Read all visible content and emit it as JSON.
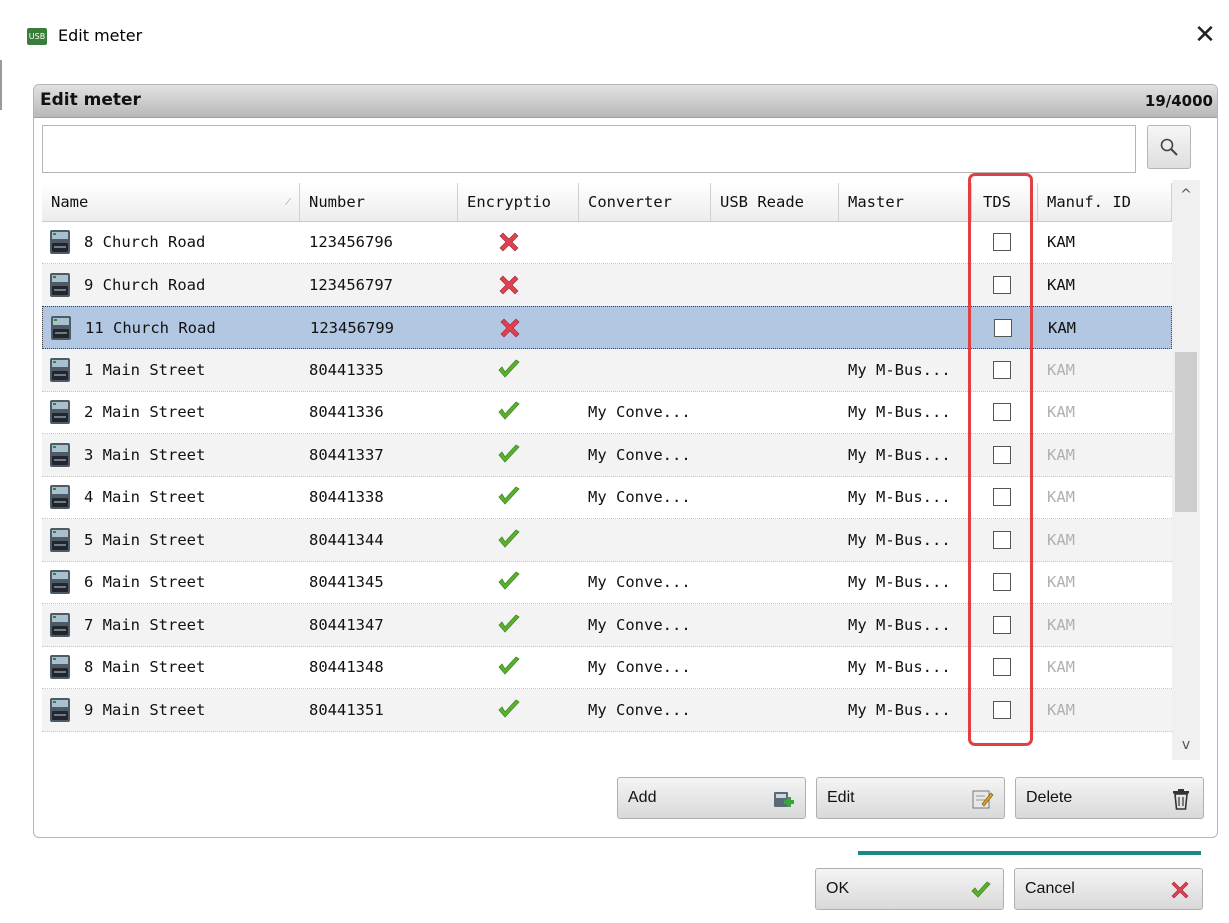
{
  "window": {
    "title": "Edit meter",
    "app_icon_text": "USB",
    "close_glyph": "✕"
  },
  "panel": {
    "title": "Edit meter",
    "count": "19/4000"
  },
  "search": {
    "value": "",
    "placeholder": ""
  },
  "columns": [
    "Name",
    "Number",
    "Encryptio",
    "Converter",
    "USB Reade",
    "Master",
    "TDS",
    "Manuf. ID"
  ],
  "rows": [
    {
      "name": "8 Church Road",
      "number": "123456796",
      "encryption": "no",
      "converter": "",
      "usb_reader": "",
      "master": "",
      "tds": false,
      "manuf": "KAM",
      "manuf_dim": false
    },
    {
      "name": "9 Church Road",
      "number": "123456797",
      "encryption": "no",
      "converter": "",
      "usb_reader": "",
      "master": "",
      "tds": false,
      "manuf": "KAM",
      "manuf_dim": false
    },
    {
      "name": "11 Church Road",
      "number": "123456799",
      "encryption": "no",
      "converter": "",
      "usb_reader": "",
      "master": "",
      "tds": false,
      "manuf": "KAM",
      "manuf_dim": false,
      "selected": true
    },
    {
      "name": "1 Main Street",
      "number": "80441335",
      "encryption": "yes",
      "converter": "",
      "usb_reader": "",
      "master": "My M-Bus...",
      "tds": false,
      "manuf": "KAM",
      "manuf_dim": true
    },
    {
      "name": "2 Main Street",
      "number": "80441336",
      "encryption": "yes",
      "converter": "My Conve...",
      "usb_reader": "",
      "master": "My M-Bus...",
      "tds": false,
      "manuf": "KAM",
      "manuf_dim": true
    },
    {
      "name": "3 Main Street",
      "number": "80441337",
      "encryption": "yes",
      "converter": "My Conve...",
      "usb_reader": "",
      "master": "My M-Bus...",
      "tds": false,
      "manuf": "KAM",
      "manuf_dim": true
    },
    {
      "name": "4 Main Street",
      "number": "80441338",
      "encryption": "yes",
      "converter": "My Conve...",
      "usb_reader": "",
      "master": "My M-Bus...",
      "tds": false,
      "manuf": "KAM",
      "manuf_dim": true
    },
    {
      "name": "5 Main Street",
      "number": "80441344",
      "encryption": "yes",
      "converter": "",
      "usb_reader": "",
      "master": "My M-Bus...",
      "tds": false,
      "manuf": "KAM",
      "manuf_dim": true
    },
    {
      "name": "6 Main Street",
      "number": "80441345",
      "encryption": "yes",
      "converter": "My Conve...",
      "usb_reader": "",
      "master": "My M-Bus...",
      "tds": false,
      "manuf": "KAM",
      "manuf_dim": true
    },
    {
      "name": "7 Main Street",
      "number": "80441347",
      "encryption": "yes",
      "converter": "My Conve...",
      "usb_reader": "",
      "master": "My M-Bus...",
      "tds": false,
      "manuf": "KAM",
      "manuf_dim": true
    },
    {
      "name": "8 Main Street",
      "number": "80441348",
      "encryption": "yes",
      "converter": "My Conve...",
      "usb_reader": "",
      "master": "My M-Bus...",
      "tds": false,
      "manuf": "KAM",
      "manuf_dim": true
    },
    {
      "name": "9 Main Street",
      "number": "80441351",
      "encryption": "yes",
      "converter": "My Conve...",
      "usb_reader": "",
      "master": "My M-Bus...",
      "tds": false,
      "manuf": "KAM",
      "manuf_dim": true
    }
  ],
  "buttons": {
    "add": "Add",
    "edit": "Edit",
    "delete": "Delete",
    "ok": "OK",
    "cancel": "Cancel"
  },
  "icons": {
    "meter": "meter-icon",
    "encryption_yes": "green-check-icon",
    "encryption_no": "red-x-icon",
    "search": "search-icon",
    "add": "add-meter-icon",
    "edit": "edit-icon",
    "delete": "trash-icon"
  },
  "colors": {
    "selected_row": "#b2c7e1",
    "highlight_border": "#e24040",
    "progress": "#1b8a86",
    "check_green": "#5cb030",
    "cross_red": "#e04050"
  }
}
